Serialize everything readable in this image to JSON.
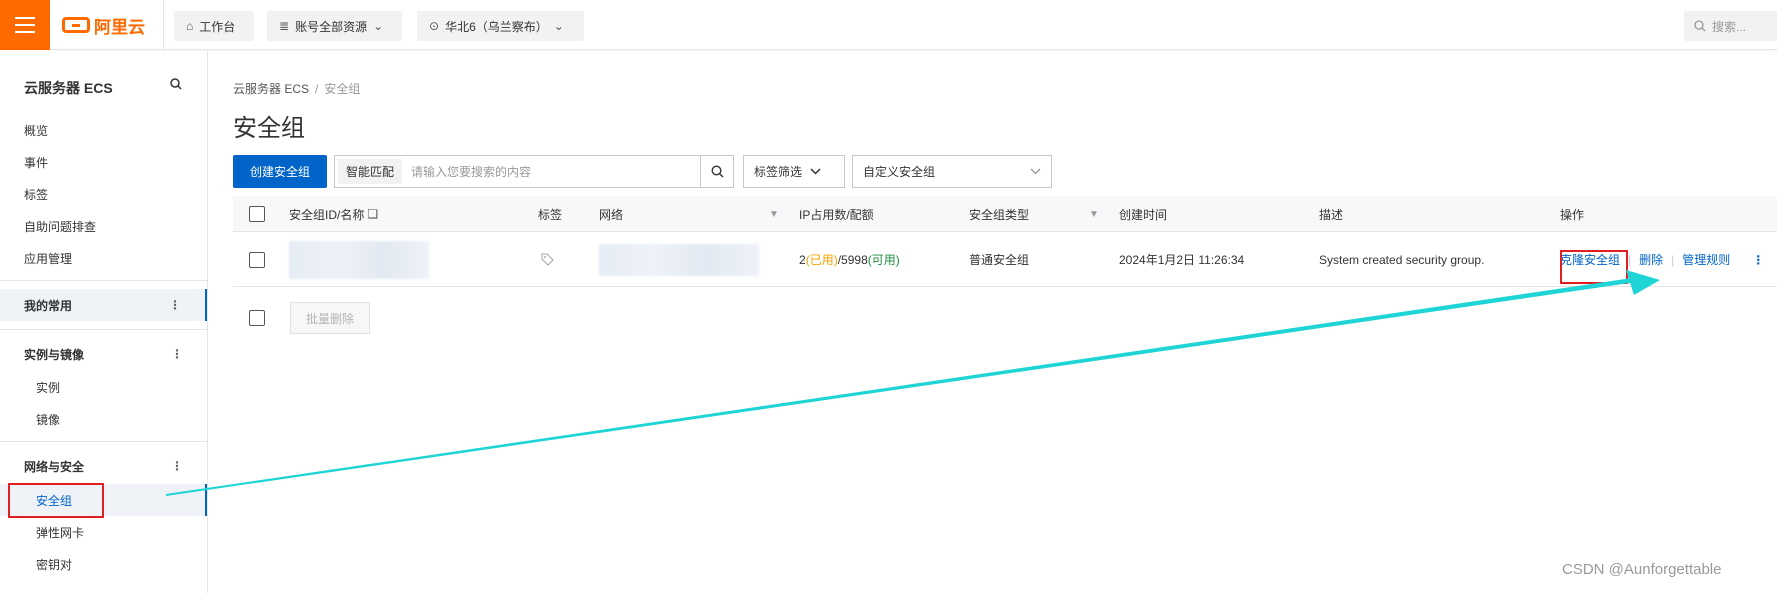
{
  "header": {
    "brand": "阿里云",
    "workbench": "工作台",
    "resources": "账号全部资源",
    "region": "华北6（乌兰察布）",
    "search_placeholder": "搜索..."
  },
  "sidebar": {
    "title": "云服务器 ECS",
    "items": [
      "概览",
      "事件",
      "标签",
      "自助问题排查",
      "应用管理"
    ],
    "favorites": "我的常用",
    "group_instances": "实例与镜像",
    "instances": [
      "实例",
      "镜像"
    ],
    "group_network": "网络与安全",
    "network_items": [
      "安全组",
      "弹性网卡",
      "密钥对"
    ],
    "more_icon": "⋮"
  },
  "main": {
    "breadcrumb": [
      "云服务器 ECS",
      "安全组"
    ],
    "breadcrumb_sep": "/",
    "title": "安全组",
    "create_button": "创建安全组",
    "smart_match": "智能匹配",
    "search_placeholder": "请输入您要搜索的内容",
    "tag_filter": "标签筛选",
    "custom_dropdown": "自定义安全组"
  },
  "table": {
    "columns": [
      "安全组ID/名称",
      "标签",
      "网络",
      "IP占用数/配额",
      "安全组类型",
      "创建时间",
      "描述",
      "操作"
    ],
    "row": {
      "ip_used": "2",
      "ip_used_label": "已用",
      "ip_quota": "5998",
      "ip_avail_label": "可用",
      "type": "普通安全组",
      "created": "2024年1月2日 11:26:34",
      "description": "System created security group.",
      "actions": [
        "克隆安全组",
        "删除",
        "管理规则"
      ]
    },
    "batch_delete": "批量删除"
  },
  "watermark": "CSDN @Aunforgettable",
  "colors": {
    "brand": "#ff6a00",
    "primary": "#0064c8",
    "highlight": "#e02020",
    "arrow": "#1fd4d4"
  }
}
